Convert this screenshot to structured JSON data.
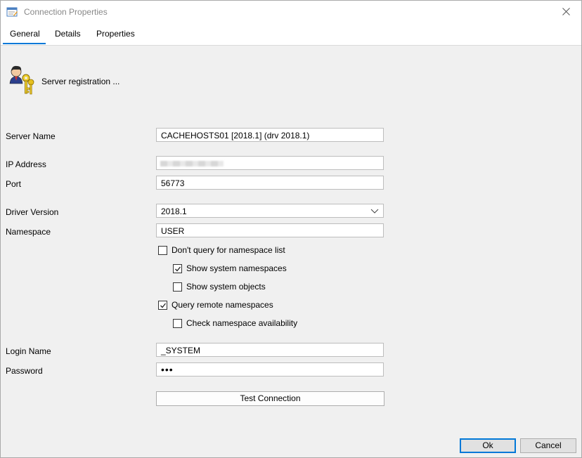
{
  "window": {
    "title": "Connection Properties",
    "close_icon": "close-icon"
  },
  "tabs": [
    {
      "label": "General",
      "active": true
    },
    {
      "label": "Details",
      "active": false
    },
    {
      "label": "Properties",
      "active": false
    }
  ],
  "header": {
    "text": "Server registration ...",
    "icon": "user-keys-icon"
  },
  "form": {
    "server_name": {
      "label": "Server Name",
      "value": "CACHEHOSTS01 [2018.1] (drv 2018.1)"
    },
    "ip_address": {
      "label": "IP Address",
      "value": ""
    },
    "port": {
      "label": "Port",
      "value": "56773"
    },
    "driver_version": {
      "label": "Driver Version",
      "value": "2018.1"
    },
    "namespace": {
      "label": "Namespace",
      "value": "USER"
    },
    "login_name": {
      "label": "Login Name",
      "value": "_SYSTEM"
    },
    "password": {
      "label": "Password",
      "value": "•••"
    }
  },
  "checkboxes": {
    "dont_query": {
      "label": "Don't query for namespace list",
      "checked": false
    },
    "show_system_namespaces": {
      "label": "Show system namespaces",
      "checked": true
    },
    "show_system_objects": {
      "label": "Show system objects",
      "checked": false
    },
    "query_remote": {
      "label": "Query remote namespaces",
      "checked": true
    },
    "check_availability": {
      "label": "Check namespace availability",
      "checked": false
    }
  },
  "buttons": {
    "test_connection": "Test Connection",
    "ok": "Ok",
    "cancel": "Cancel"
  },
  "colors": {
    "accent": "#0078d7",
    "background": "#f0f0f0"
  }
}
